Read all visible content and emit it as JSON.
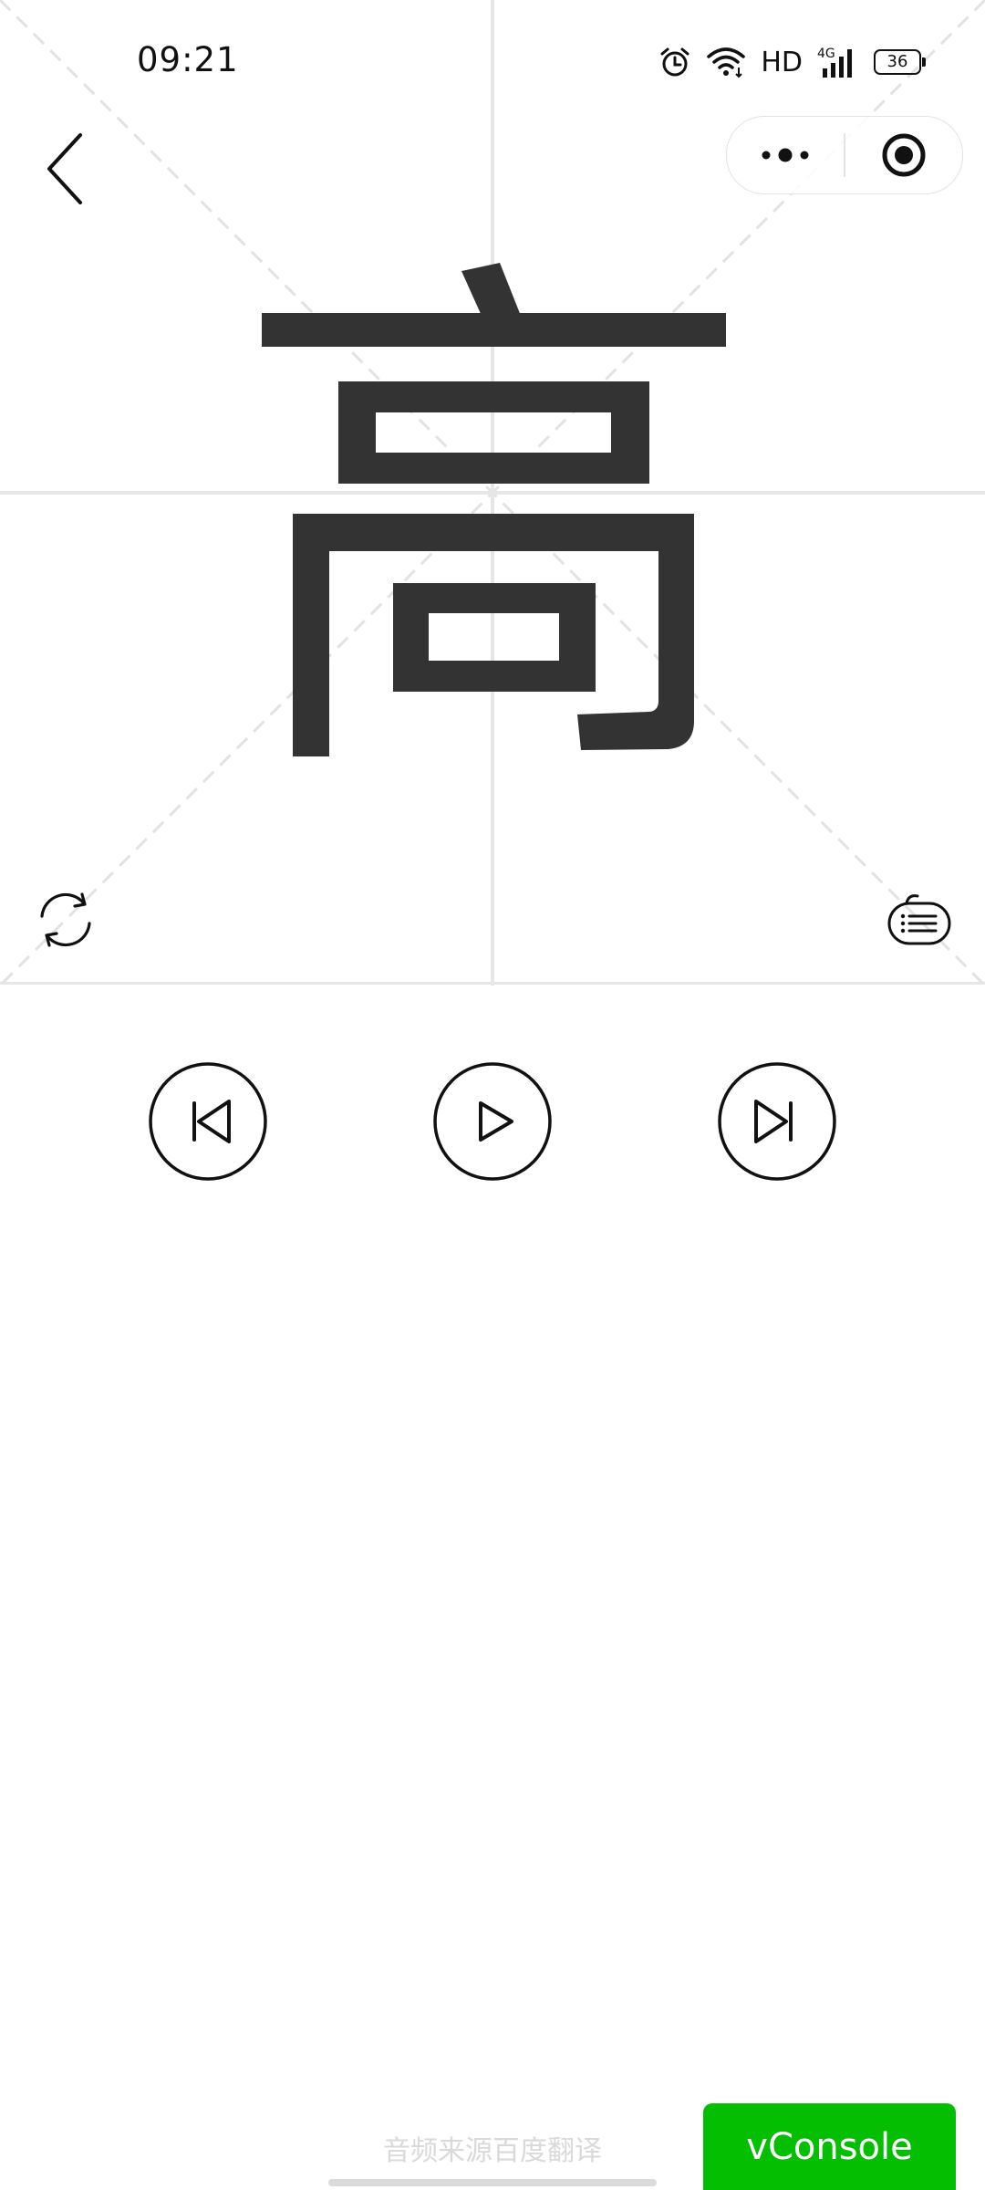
{
  "status_bar": {
    "time": "09:21",
    "network_label": "HD",
    "cellular_label": "4G",
    "battery_level": "36"
  },
  "nav": {
    "back_icon": "chevron-left-icon",
    "more_icon": "more-dots-icon",
    "close_icon": "target-circle-icon"
  },
  "character": {
    "glyph": "高",
    "color": "#333333"
  },
  "grid": {
    "line_color": "#e6e6e6",
    "diagonal_color": "#e2e2e2"
  },
  "controls": {
    "refresh_icon": "refresh-icon",
    "list_icon": "list-bubble-icon",
    "prev_icon": "skip-previous-icon",
    "play_icon": "play-icon",
    "next_icon": "skip-next-icon"
  },
  "footer": {
    "audio_source": "音频来源百度翻译",
    "vconsole_label": "vConsole",
    "vconsole_color": "#04be02"
  }
}
